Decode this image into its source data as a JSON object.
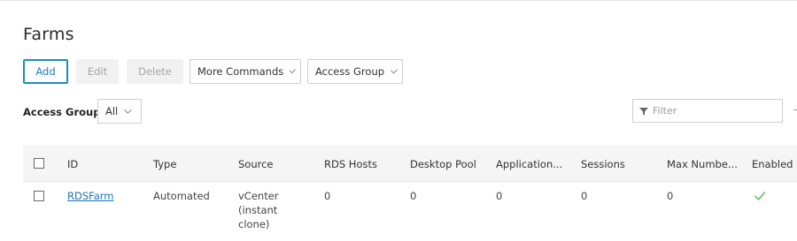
{
  "page": {
    "title": "Farms"
  },
  "toolbar": {
    "add_label": "Add",
    "edit_label": "Edit",
    "delete_label": "Delete",
    "more_commands_label": "More Commands",
    "access_group_label": "Access Group"
  },
  "filters": {
    "access_group_label": "Access Group",
    "access_group_value": "All",
    "search_placeholder": "Filter"
  },
  "table": {
    "columns": [
      "ID",
      "Type",
      "Source",
      "RDS Hosts",
      "Desktop Pool",
      "Application...",
      "Sessions",
      "Max Numbe...",
      "Enabled"
    ],
    "rows": [
      {
        "id": "RDSFarm",
        "type": "Automated",
        "source": "vCenter (instant clone)",
        "rds_hosts": "0",
        "desktop_pool": "0",
        "applications": "0",
        "sessions": "0",
        "max_number": "0",
        "enabled": true
      }
    ]
  },
  "colors": {
    "accent": "#1e88c7",
    "link": "#1a73b8",
    "enabled_check": "#5cb85c"
  },
  "icons": {
    "filter": "funnel-icon",
    "enabled": "checkmark-icon",
    "dropdown": "chevron-down-icon"
  }
}
